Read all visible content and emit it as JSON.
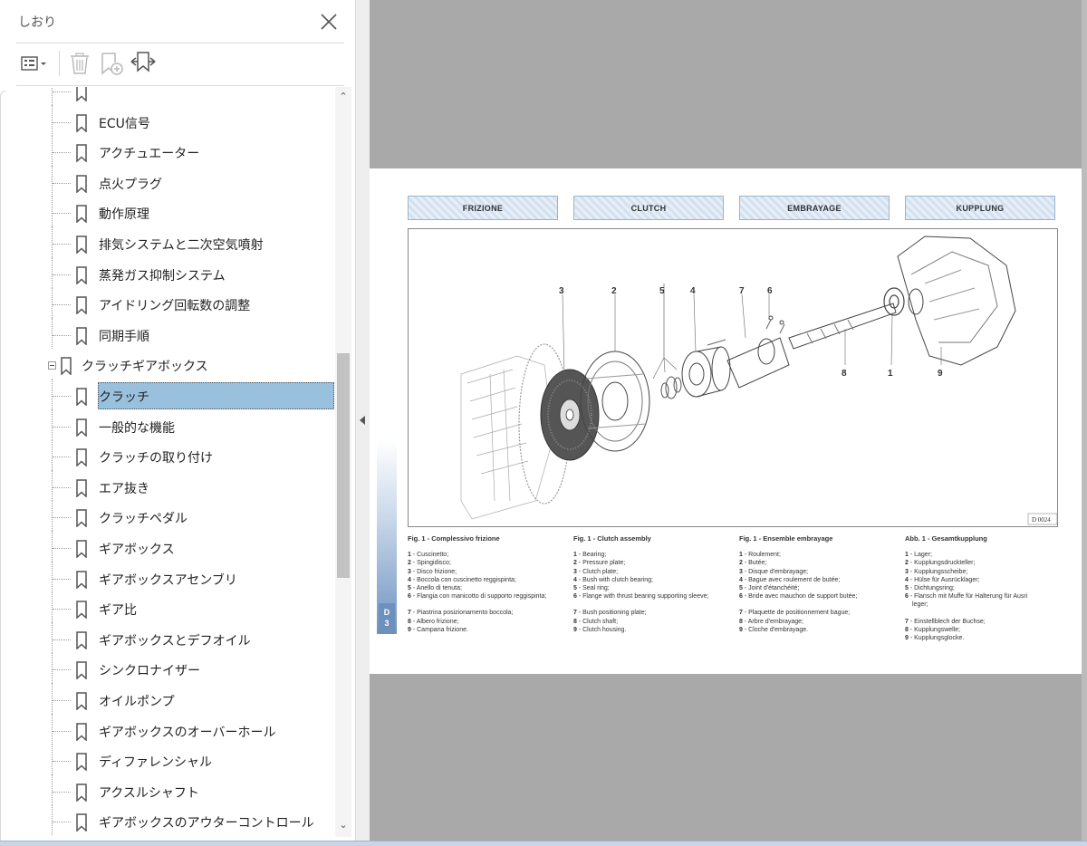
{
  "panel": {
    "title": "しおり",
    "close_icon": "close-icon",
    "toolbar": {
      "options_icon": "bookmark-options-icon",
      "delete_icon": "trash-icon",
      "add_icon": "add-bookmark-icon",
      "tag_icon": "find-current-bookmark-icon"
    }
  },
  "tree": {
    "items": [
      {
        "label": "",
        "level": 2
      },
      {
        "label": "ECU信号",
        "level": 2
      },
      {
        "label": "アクチュエーター",
        "level": 2
      },
      {
        "label": "点火プラグ",
        "level": 2
      },
      {
        "label": "動作原理",
        "level": 2
      },
      {
        "label": "排気システムと二次空気噴射",
        "level": 2
      },
      {
        "label": "蒸発ガス抑制システム",
        "level": 2
      },
      {
        "label": "アイドリング回転数の調整",
        "level": 2
      },
      {
        "label": "同期手順",
        "level": 2
      },
      {
        "label": "クラッチギアボックス",
        "level": 1
      },
      {
        "label": "クラッチ",
        "level": 2,
        "selected": true
      },
      {
        "label": "一般的な機能",
        "level": 2
      },
      {
        "label": "クラッチの取り付け",
        "level": 2
      },
      {
        "label": "エア抜き",
        "level": 2
      },
      {
        "label": "クラッチペダル",
        "level": 2
      },
      {
        "label": "ギアボックス",
        "level": 2
      },
      {
        "label": "ギアボックスアセンブリ",
        "level": 2
      },
      {
        "label": "ギア比",
        "level": 2
      },
      {
        "label": "ギアボックスとデフオイル",
        "level": 2
      },
      {
        "label": "シンクロナイザー",
        "level": 2
      },
      {
        "label": "オイルポンプ",
        "level": 2
      },
      {
        "label": "ギアボックスのオーバーホール",
        "level": 2
      },
      {
        "label": "ディファレンシャル",
        "level": 2
      },
      {
        "label": "アクスルシャフト",
        "level": 2
      },
      {
        "label": "ギアボックスのアウターコントロール",
        "level": 2
      }
    ]
  },
  "scroll": {
    "up": "⌃",
    "down": "⌄"
  },
  "document": {
    "tabs": [
      "FRIZIONE",
      "CLUTCH",
      "EMBRAYAGE",
      "KUPPLUNG"
    ],
    "figure": {
      "callouts_top": [
        "3",
        "2",
        "5",
        "4",
        "7",
        "6"
      ],
      "callouts_bottom": [
        "8",
        "1",
        "9"
      ],
      "code": "D 0024"
    },
    "side_tag": {
      "line1": "D",
      "line2": "3"
    },
    "captions": [
      {
        "title": "Fig. 1 - Complessivo frizione",
        "items": [
          {
            "n": "1",
            "t": " - Cuscinetto;"
          },
          {
            "n": "2",
            "t": " - Spingidisco;"
          },
          {
            "n": "3",
            "t": " - Disco frizione;"
          },
          {
            "n": "4",
            "t": " - Boccola con cuscinetto reggispinta;"
          },
          {
            "n": "5",
            "t": " - Anello di tenuta;"
          },
          {
            "n": "6",
            "t": " - Flangia con manicotto di supporto reggispinta;"
          },
          {
            "n": "7",
            "t": " - Piastrina posizionamento boccola;"
          },
          {
            "n": "8",
            "t": " - Albero frizione;"
          },
          {
            "n": "9",
            "t": " - Campana frizione."
          }
        ]
      },
      {
        "title": "Fig. 1 - Clutch assembly",
        "items": [
          {
            "n": "1",
            "t": " - Bearing;"
          },
          {
            "n": "2",
            "t": " - Pressure plate;"
          },
          {
            "n": "3",
            "t": " - Clutch plate;"
          },
          {
            "n": "4",
            "t": " - Bush with clutch bearing;"
          },
          {
            "n": "5",
            "t": " - Seal ring;"
          },
          {
            "n": "6",
            "t": " - Flange with thrust bearing supporting sleeve;"
          },
          {
            "n": "7",
            "t": " - Bush positioning plate;"
          },
          {
            "n": "8",
            "t": " - Clutch shaft;"
          },
          {
            "n": "9",
            "t": " - Clutch housing."
          }
        ]
      },
      {
        "title": "Fig. 1 - Ensemble embrayage",
        "items": [
          {
            "n": "1",
            "t": " - Roulement;"
          },
          {
            "n": "2",
            "t": " - Butée;"
          },
          {
            "n": "3",
            "t": " - Disque d'embrayage;"
          },
          {
            "n": "4",
            "t": " - Bague avec roulement de butée;"
          },
          {
            "n": "5",
            "t": " - Joint d'étanchéité;"
          },
          {
            "n": "6",
            "t": " - Bride avec mauchon de support butée;"
          },
          {
            "n": "7",
            "t": " - Plaquette de positionnement bague;"
          },
          {
            "n": "8",
            "t": " - Arbre d'embrayage;"
          },
          {
            "n": "9",
            "t": " - Cloche d'embrayage."
          }
        ]
      },
      {
        "title": "Abb. 1 - Gesamtkupplung",
        "items": [
          {
            "n": "1",
            "t": " - Lager;"
          },
          {
            "n": "2",
            "t": " - Kupplungsdruckteller;"
          },
          {
            "n": "3",
            "t": " - Kupplungsscheibe;"
          },
          {
            "n": "4",
            "t": " - Hülse für Ausrücklager;"
          },
          {
            "n": "5",
            "t": " - Dichtungsring;"
          },
          {
            "n": "6",
            "t": " - Flansch mit Muffe für Halterung für Ausri"
          },
          {
            "n": "",
            "t": "leger;"
          },
          {
            "n": "7",
            "t": " - Einstellblech der Buchse;"
          },
          {
            "n": "8",
            "t": " - Kupplungswelle;"
          },
          {
            "n": "9",
            "t": " - Kupplungsglocke."
          }
        ]
      }
    ]
  }
}
